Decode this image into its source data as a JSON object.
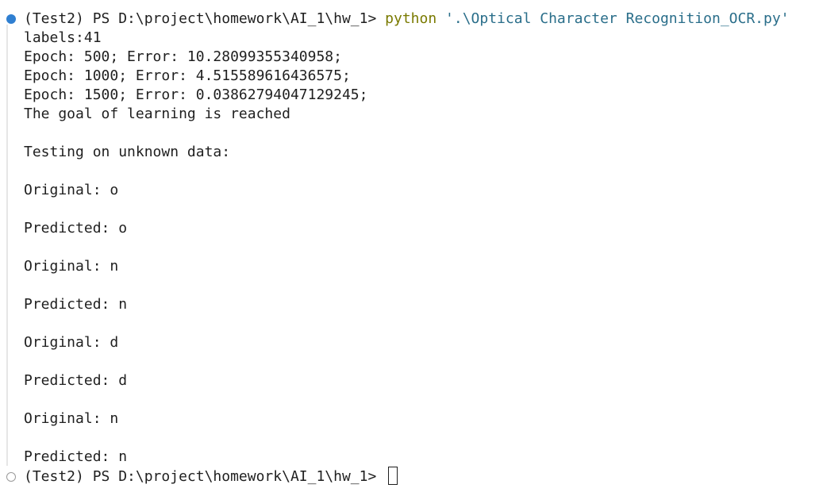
{
  "prompt": "(Test2) PS D:\\project\\homework\\AI_1\\hw_1> ",
  "command": "python",
  "command_arg": "'.\\Optical Character Recognition_OCR.py'",
  "output_lines": [
    "labels:41",
    "Epoch: 500; Error: 10.28099355340958;",
    "Epoch: 1000; Error: 4.515589616436575;",
    "Epoch: 1500; Error: 0.03862794047129245;",
    "The goal of learning is reached",
    "Testing on unknown data:",
    "Original: o",
    "Predicted: o",
    "Original: n",
    "Predicted: n",
    "Original: d",
    "Predicted: d",
    "Original: n",
    "Predicted: n"
  ],
  "final_prompt": "(Test2) PS D:\\project\\homework\\AI_1\\hw_1> ",
  "colors": {
    "command": "#7a7a00",
    "argument": "#2a6e8a",
    "success_marker": "#2f7fd1"
  }
}
